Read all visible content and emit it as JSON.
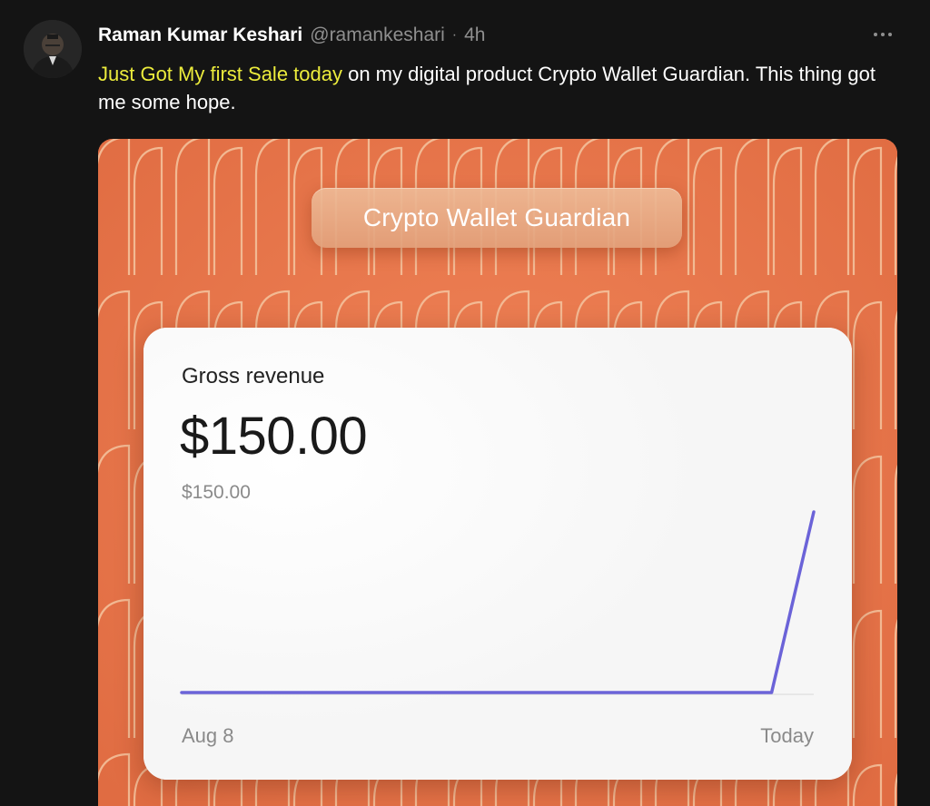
{
  "post": {
    "author_name": "Raman Kumar Keshari",
    "handle": "@ramankeshari",
    "separator": "·",
    "time": "4h",
    "text_highlight": "Just Got My first Sale today",
    "text_rest": " on my digital product Crypto Wallet Guardian. This thing got me some hope."
  },
  "media": {
    "product_title": "Crypto Wallet Guardian",
    "card": {
      "label": "Gross revenue",
      "amount": "$150.00",
      "sub_amount": "$150.00"
    }
  },
  "colors": {
    "background": "#141414",
    "highlight": "#ecec3c",
    "media_orange": "#e7764b",
    "line": "#6b63d8"
  },
  "icons": {
    "more": "more-horizontal-icon",
    "avatar": "avatar"
  },
  "chart_data": {
    "type": "line",
    "x": [
      "Aug 8",
      "Today"
    ],
    "xlabel": "",
    "ylabel": "",
    "series": [
      {
        "values": [
          0,
          0,
          0,
          0,
          0,
          0,
          0,
          0,
          0,
          0,
          0,
          0,
          0,
          0,
          0,
          150
        ]
      }
    ],
    "ylim": [
      0,
      150
    ],
    "grid": false
  }
}
